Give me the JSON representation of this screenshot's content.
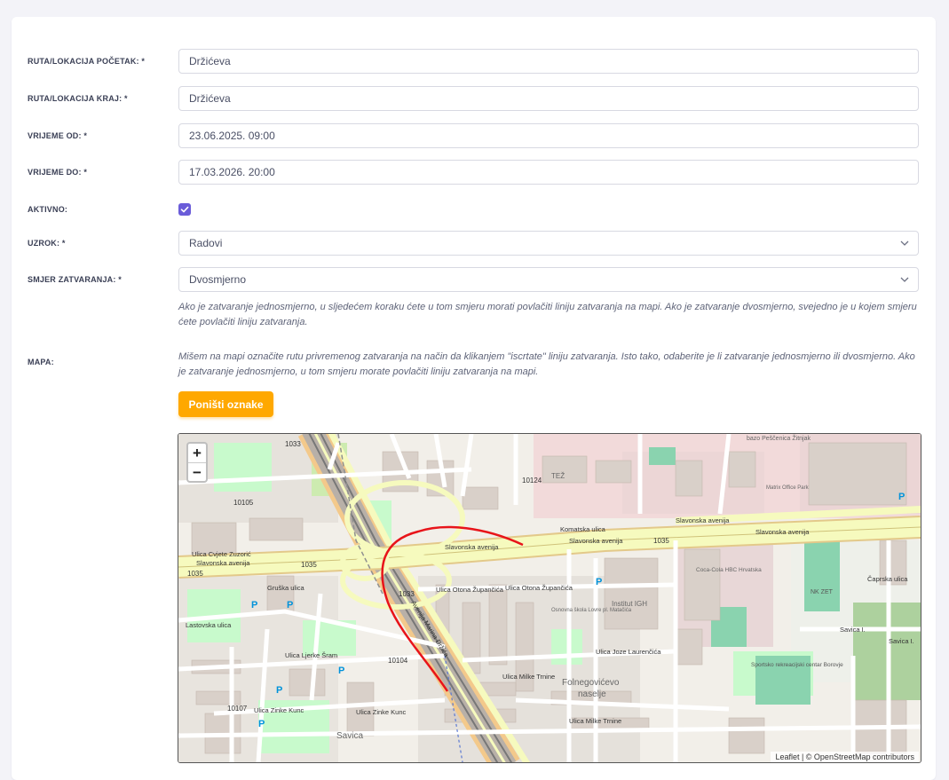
{
  "form": {
    "start_label": "RUTA/LOKACIJA POČETAK: *",
    "start_value": "Držićeva",
    "end_label": "RUTA/LOKACIJA KRAJ: *",
    "end_value": "Držićeva",
    "from_label": "VRIJEME OD: *",
    "from_value": "23.06.2025. 09:00",
    "to_label": "VRIJEME DO: *",
    "to_value": "17.03.2026. 20:00",
    "active_label": "AKTIVNO:",
    "active_checked": true,
    "cause_label": "UZROK: *",
    "cause_value": "Radovi",
    "direction_label": "SMJER ZATVARANJA: *",
    "direction_value": "Dvosmjerno",
    "direction_help": "Ako je zatvaranje jednosmjerno, u sljedećem koraku ćete u tom smjeru morati povlačiti liniju zatvaranja na mapi. Ako je zatvaranje dvosmjerno, svejedno je u kojem smjeru ćete povlačiti liniju zatvaranja.",
    "map_label": "MAPA:",
    "map_help": "Mišem na mapi označite rutu privremenog zatvaranja na način da klikanjem \"iscrtate\" liniju zatvaranja. Isto tako, odaberite je li zatvaranje jednosmjerno ili dvosmjerno. Ako je zatvaranje jednosmjerno, u tom smjeru morate povlačiti liniju zatvaranja na mapi.",
    "reset_button": "Poništi oznake"
  },
  "map": {
    "zoom_in": "+",
    "zoom_out": "−",
    "attribution": "Leaflet | © OpenStreetMap contributors",
    "labels": {
      "slavonska_1": "Slavonska avenija",
      "slavonska_2": "Slavonska avenija",
      "slavonska_3": "Slavonska avenija",
      "slavonska_4": "Slavonska avenija",
      "slavonska_5": "Slavonska avenija",
      "komatska": "Komatska ulica",
      "cvjete_zuzoric": "Ulica Cvjete Zuzorić",
      "gruska": "Gruška ulica",
      "lastovska": "Lastovska ulica",
      "ljerke_sram": "Ulica Ljerke Šram",
      "milke_trnine": "Ulica Milke Trnine",
      "milke_trnine_2": "Ulica Milke Trnine",
      "zinke_kunc": "Ulica Zinke Kunc",
      "zinke_kunc_2": "Ulica Zinke Kunc",
      "otona_1": "Ulica Otona Župančića",
      "otona_2": "Ulica Otona Župančića",
      "joze_laurencica": "Ulica Joze Laurenčića",
      "savica_1": "Savica I.",
      "savica_2": "Savica I.",
      "savica": "Savica",
      "caprska": "Čaprska ulica",
      "marina_drzica": "Avenija Marina Držića",
      "folnegovicevo": "Folnegovićevo",
      "naselje": "naselje",
      "institut_igh": "Institut IGH",
      "coca_cola": "Coca-Cola HBC Hrvatska",
      "nk_zet": "NK ZET",
      "sportsko": "Sportsko rekreacijski centar Borovje",
      "tez": "TEŽ",
      "pescenica": "bazo Peščenica Žitnjak",
      "matrix": "Matrix Office Park",
      "osnovna_skola": "Osnovna škola Lovre pl. Matačića",
      "r_1033a": "1033",
      "r_1033b": "1033",
      "r_1035a": "1035",
      "r_1035b": "1035",
      "r_1035c": "1035",
      "r_10105": "10105",
      "r_10124": "10124",
      "r_10104": "10104",
      "r_10107": "10107"
    }
  },
  "colors": {
    "accent": "#6a5cd9",
    "button": "#ffa800",
    "closure_line": "#e8141a"
  }
}
